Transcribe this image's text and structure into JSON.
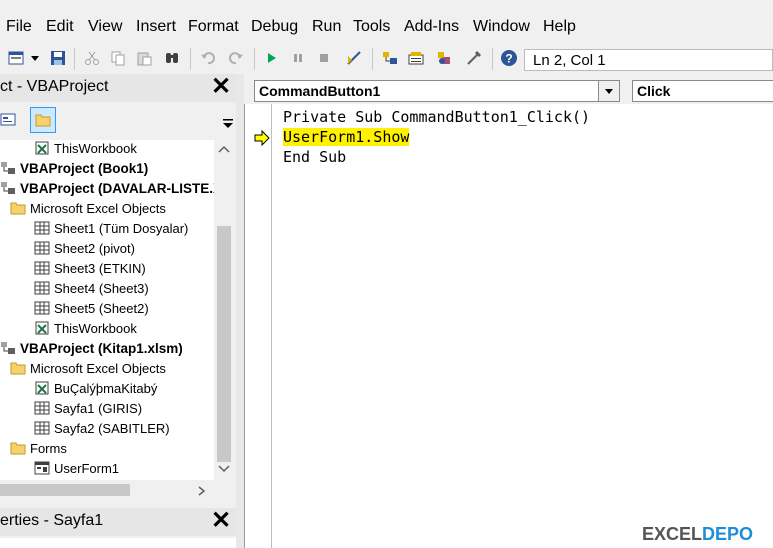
{
  "menubar": {
    "items": [
      "File",
      "Edit",
      "View",
      "Insert",
      "Format",
      "Debug",
      "Run",
      "Tools",
      "Add-Ins",
      "Window",
      "Help"
    ]
  },
  "toolbar": {
    "status": "Ln 2, Col 1"
  },
  "project_panel": {
    "title": "ct - VBAProject",
    "tree": [
      {
        "label": "ThisWorkbook",
        "bold": false,
        "icon": "workbook-icon"
      },
      {
        "label": "VBAProject (Book1)",
        "bold": true,
        "icon": "vba-project-icon"
      },
      {
        "label": "VBAProject (DAVALAR-LISTE.X",
        "bold": true,
        "icon": "vba-project-icon"
      },
      {
        "label": "Microsoft Excel Objects",
        "bold": false,
        "icon": "folder-icon"
      },
      {
        "label": "Sheet1 (Tüm Dosyalar)",
        "bold": false,
        "icon": "sheet-icon"
      },
      {
        "label": "Sheet2 (pivot)",
        "bold": false,
        "icon": "sheet-icon"
      },
      {
        "label": "Sheet3 (ETKIN)",
        "bold": false,
        "icon": "sheet-icon"
      },
      {
        "label": "Sheet4 (Sheet3)",
        "bold": false,
        "icon": "sheet-icon"
      },
      {
        "label": "Sheet5 (Sheet2)",
        "bold": false,
        "icon": "sheet-icon"
      },
      {
        "label": "ThisWorkbook",
        "bold": false,
        "icon": "workbook-icon"
      },
      {
        "label": "VBAProject (Kitap1.xlsm)",
        "bold": true,
        "icon": "vba-project-icon"
      },
      {
        "label": "Microsoft Excel Objects",
        "bold": false,
        "icon": "folder-icon"
      },
      {
        "label": "BuÇalýþmaKitabý",
        "bold": false,
        "icon": "workbook-icon"
      },
      {
        "label": "Sayfa1 (GIRIS)",
        "bold": false,
        "icon": "sheet-icon"
      },
      {
        "label": "Sayfa2 (SABITLER)",
        "bold": false,
        "icon": "sheet-icon"
      },
      {
        "label": "Forms",
        "bold": false,
        "icon": "folder-icon"
      },
      {
        "label": "UserForm1",
        "bold": false,
        "icon": "userform-icon"
      }
    ]
  },
  "properties_panel": {
    "title": "erties - Sayfa1"
  },
  "code_window": {
    "object_combo": "CommandButton1",
    "proc_combo": "Click",
    "lines": [
      "Private Sub CommandButton1_Click()",
      "UserForm1.Show",
      "End Sub"
    ]
  },
  "watermark": {
    "part1": "EXCEL",
    "part2": "DEPO"
  },
  "colors": {
    "highlight": "#fff200",
    "accent": "#1c8fd6"
  }
}
